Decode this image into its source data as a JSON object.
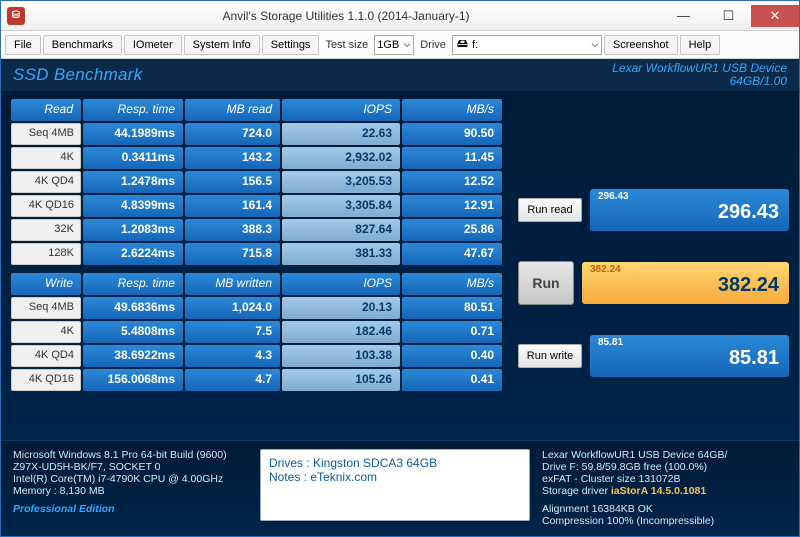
{
  "window": {
    "title": "Anvil's Storage Utilities 1.1.0 (2014-January-1)",
    "app_icon_glyph": "⛁"
  },
  "toolbar": {
    "file": "File",
    "benchmarks": "Benchmarks",
    "iometer": "IOmeter",
    "sysinfo": "System Info",
    "settings": "Settings",
    "testsize_label": "Test size",
    "testsize_value": "1GB",
    "drive_label": "Drive",
    "drive_value": "f:",
    "screenshot": "Screenshot",
    "help": "Help"
  },
  "header": {
    "title": "SSD Benchmark",
    "device_line1": "Lexar WorkflowUR1 USB Device",
    "device_line2": "64GB/1.00"
  },
  "read_hdr": {
    "c0": "Read",
    "c1": "Resp. time",
    "c2": "MB read",
    "c3": "IOPS",
    "c4": "MB/s"
  },
  "write_hdr": {
    "c0": "Write",
    "c1": "Resp. time",
    "c2": "MB written",
    "c3": "IOPS",
    "c4": "MB/s"
  },
  "read": [
    {
      "label": "Seq 4MB",
      "resp": "44.1989ms",
      "mb": "724.0",
      "iops": "22.63",
      "mbs": "90.50"
    },
    {
      "label": "4K",
      "resp": "0.3411ms",
      "mb": "143.2",
      "iops": "2,932.02",
      "mbs": "11.45"
    },
    {
      "label": "4K QD4",
      "resp": "1.2478ms",
      "mb": "156.5",
      "iops": "3,205.53",
      "mbs": "12.52"
    },
    {
      "label": "4K QD16",
      "resp": "4.8399ms",
      "mb": "161.4",
      "iops": "3,305.84",
      "mbs": "12.91"
    },
    {
      "label": "32K",
      "resp": "1.2083ms",
      "mb": "388.3",
      "iops": "827.64",
      "mbs": "25.86"
    },
    {
      "label": "128K",
      "resp": "2.6224ms",
      "mb": "715.8",
      "iops": "381.33",
      "mbs": "47.67"
    }
  ],
  "write": [
    {
      "label": "Seq 4MB",
      "resp": "49.6836ms",
      "mb": "1,024.0",
      "iops": "20.13",
      "mbs": "80.51"
    },
    {
      "label": "4K",
      "resp": "5.4808ms",
      "mb": "7.5",
      "iops": "182.46",
      "mbs": "0.71"
    },
    {
      "label": "4K QD4",
      "resp": "38.6922ms",
      "mb": "4.3",
      "iops": "103.38",
      "mbs": "0.40"
    },
    {
      "label": "4K QD16",
      "resp": "156.0068ms",
      "mb": "4.7",
      "iops": "105.26",
      "mbs": "0.41"
    }
  ],
  "side": {
    "run_read_label": "Run read",
    "read_score_small": "296.43",
    "read_score": "296.43",
    "run_label": "Run",
    "total_score_small": "382.24",
    "total_score": "382.24",
    "run_write_label": "Run write",
    "write_score_small": "85.81",
    "write_score": "85.81"
  },
  "footer": {
    "sys1": "Microsoft Windows 8.1 Pro 64-bit Build (9600)",
    "sys2": "Z97X-UD5H-BK/F7, SOCKET 0",
    "sys3": "Intel(R) Core(TM) i7-4790K CPU @ 4.00GHz",
    "sys4": "Memory : 8,130 MB",
    "pro": "Professional Edition",
    "notes_drives": "Drives : Kingston SDCA3 64GB",
    "notes_notes": "Notes : eTeknix.com",
    "dev_line": "Lexar WorkflowUR1 USB Device 64GB/",
    "drive_free": "Drive F: 59.8/59.8GB free (100.0%)",
    "fs": "exFAT - Cluster size 131072B",
    "driver_label": "Storage driver ",
    "driver_value": "iaStorA 14.5.0.1081",
    "alignment": "Alignment 16384KB OK",
    "compression": "Compression 100% (Incompressible)"
  }
}
